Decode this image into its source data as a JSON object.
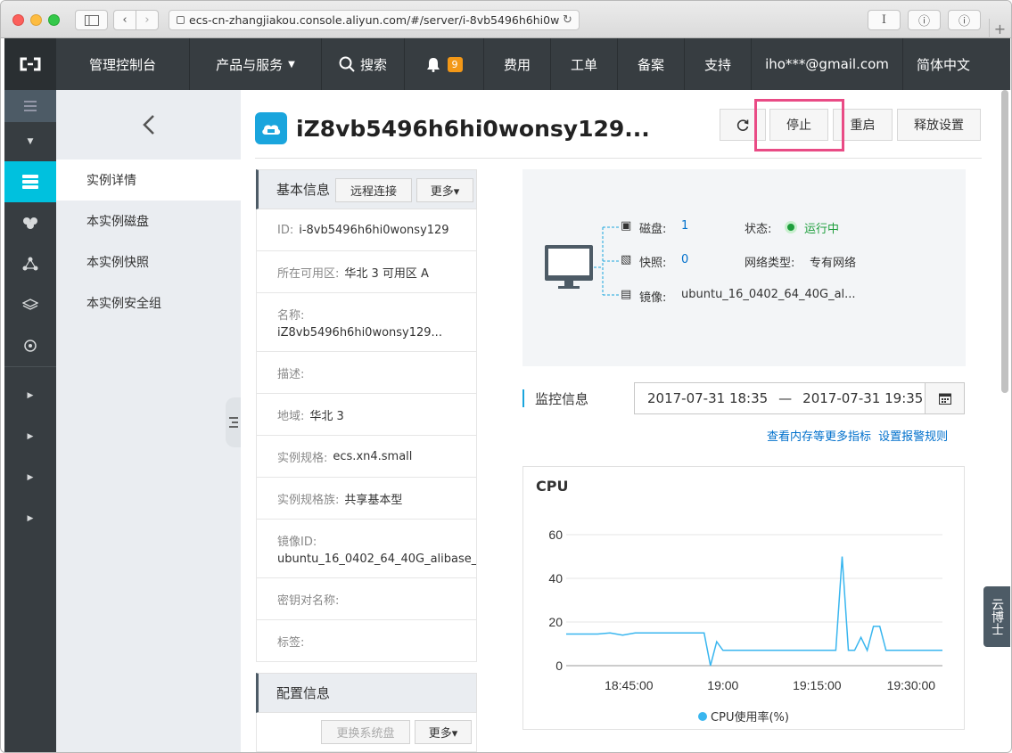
{
  "browser": {
    "url": "ecs-cn-zhangjiakou.console.aliyun.com/#/server/i-8vb5496h6hi0w",
    "reader_label": "I",
    "btn2_label": "ⓘ",
    "btn3_label": "ⓘ",
    "plus": "+"
  },
  "topnav": {
    "console": "管理控制台",
    "products": "产品与服务",
    "search": "搜索",
    "notifications": "9",
    "billing": "费用",
    "tickets": "工单",
    "filing": "备案",
    "support": "支持",
    "account": "iho***@gmail.com",
    "language": "简体中文"
  },
  "sidebar": {
    "items": [
      {
        "label": "实例详情"
      },
      {
        "label": "本实例磁盘"
      },
      {
        "label": "本实例快照"
      },
      {
        "label": "本实例安全组"
      }
    ]
  },
  "instance": {
    "title": "iZ8vb5496h6hi0wonsy129...",
    "stop": "停止",
    "restart": "重启",
    "release": "释放设置"
  },
  "basic": {
    "header": "基本信息",
    "remote": "远程连接",
    "more": "更多▾",
    "fields": [
      {
        "label": "ID:",
        "value": "i-8vb5496h6hi0wonsy129"
      },
      {
        "label": "所在可用区:",
        "value": "华北 3 可用区 A"
      },
      {
        "label": "名称:",
        "value": "iZ8vb5496h6hi0wonsy129..."
      },
      {
        "label": "描述:",
        "value": ""
      },
      {
        "label": "地域:",
        "value": "华北 3"
      },
      {
        "label": "实例规格:",
        "value": "ecs.xn4.small"
      },
      {
        "label": "实例规格族:",
        "value": "共享基本型"
      },
      {
        "label": "镜像ID:",
        "value": "ubuntu_16_0402_64_40G_alibase_..."
      },
      {
        "label": "密钥对名称:",
        "value": ""
      },
      {
        "label": "标签:",
        "value": ""
      }
    ]
  },
  "config": {
    "header": "配置信息",
    "change_os": "更换系统盘",
    "more": "更多▾"
  },
  "overview": {
    "disk_label": "磁盘:",
    "disk_value": "1",
    "snapshot_label": "快照:",
    "snapshot_value": "0",
    "image_label": "镜像:",
    "image_value": "ubuntu_16_0402_64_40G_al...",
    "status_label": "状态:",
    "status_value": "运行中",
    "network_label": "网络类型:",
    "network_value": "专有网络"
  },
  "monitor": {
    "title": "监控信息",
    "start": "2017-07-31 18:35",
    "sep": "—",
    "end": "2017-07-31 19:35",
    "link_more": "查看内存等更多指标",
    "link_alarm": "设置报警规则"
  },
  "doctor": "云博士",
  "colors": {
    "accent": "#00c1de",
    "link": "#0070cc",
    "status": "#1e9e3c",
    "series": "#39b6ef",
    "highlight": "#e94b85"
  },
  "chart_data": {
    "type": "line",
    "title": "CPU",
    "ylim": [
      0,
      60
    ],
    "yticks": [
      0,
      20,
      40,
      60
    ],
    "xticks": [
      "18:45:00",
      "19:00",
      "19:15:00",
      "19:30:00"
    ],
    "series": [
      {
        "name": "CPU使用率(%)",
        "x": [
          "18:35",
          "18:38",
          "18:40",
          "18:42",
          "18:44",
          "18:46",
          "18:50",
          "18:54",
          "18:57",
          "18:58",
          "18:59",
          "19:00",
          "19:02",
          "19:06",
          "19:10",
          "19:14",
          "19:16",
          "19:18",
          "19:19",
          "19:20",
          "19:21",
          "19:22",
          "19:23",
          "19:24",
          "19:25",
          "19:26",
          "19:27",
          "19:28",
          "19:29",
          "19:30",
          "19:33",
          "19:35"
        ],
        "values": [
          14.5,
          14.5,
          14.5,
          15,
          14,
          15,
          15,
          15,
          15,
          0,
          11,
          7,
          7,
          7,
          7,
          7,
          7,
          7,
          50,
          7,
          7,
          13,
          7,
          18,
          18,
          7,
          7,
          7,
          7,
          7,
          7,
          7
        ]
      }
    ]
  }
}
